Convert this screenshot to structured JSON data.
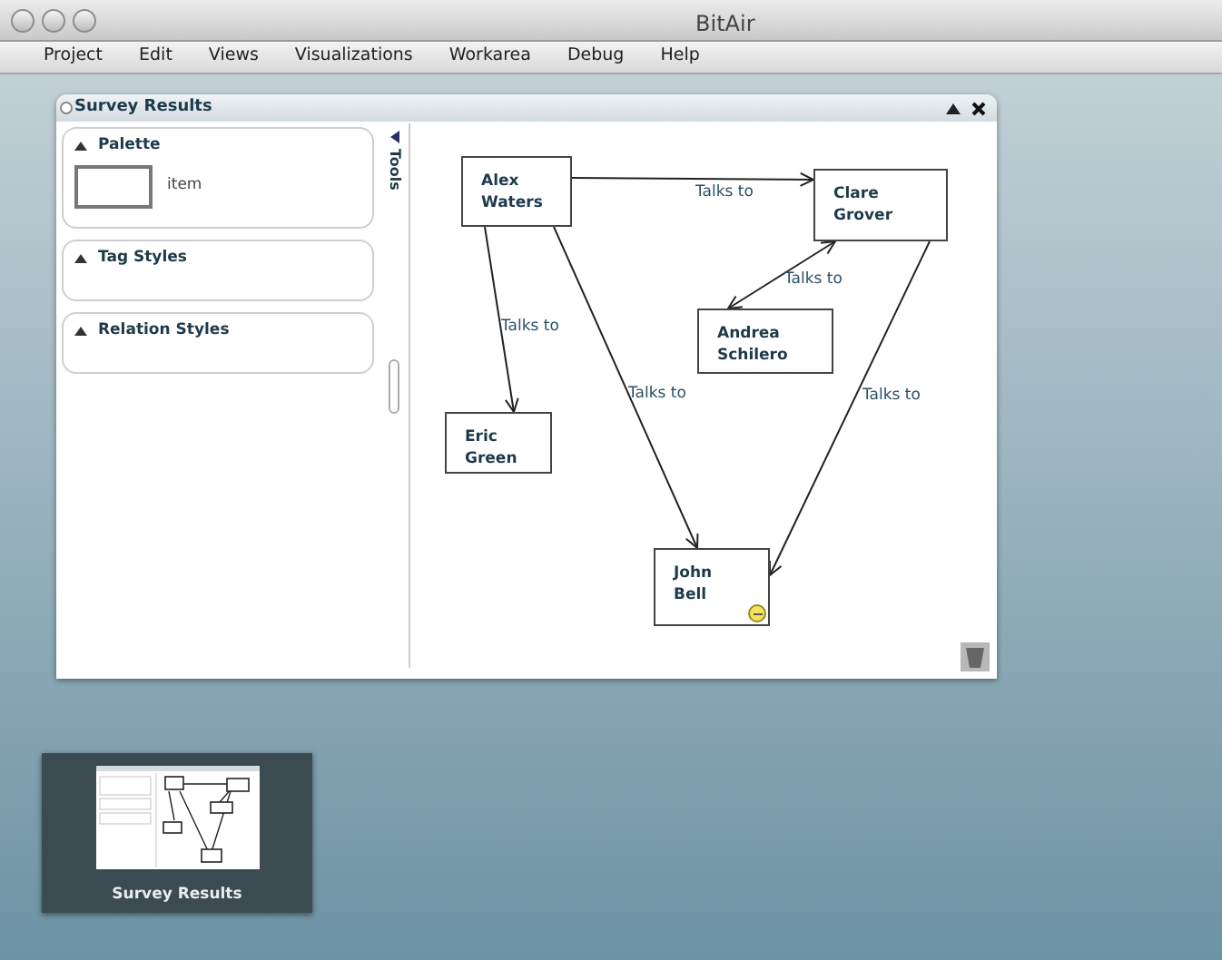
{
  "window": {
    "title": "BitAir"
  },
  "menu": [
    "Project",
    "Edit",
    "Views",
    "Visualizations",
    "Workarea",
    "Debug",
    "Help"
  ],
  "panel": {
    "title": "Survey Results",
    "sections": [
      {
        "title": "Palette",
        "expanded": true,
        "item_label": "item"
      },
      {
        "title": "Tag Styles",
        "expanded": true
      },
      {
        "title": "Relation Styles",
        "expanded": true
      }
    ],
    "tools_label": "Tools",
    "nodes": [
      {
        "lines": [
          "Alex",
          "Waters"
        ],
        "marked": false
      },
      {
        "lines": [
          "Clare",
          "Grover"
        ],
        "marked": false
      },
      {
        "lines": [
          "Andrea",
          "Schilero"
        ],
        "marked": false
      },
      {
        "lines": [
          "Eric",
          "Green"
        ],
        "marked": false
      },
      {
        "lines": [
          "John",
          "Bell"
        ],
        "marked": true
      }
    ],
    "edges": [
      {
        "label": "Talks to",
        "both_ways": false
      },
      {
        "label": "Talks to",
        "both_ways": false
      },
      {
        "label": "Talks to",
        "both_ways": false
      },
      {
        "label": "Talks to",
        "both_ways": true
      },
      {
        "label": "Talks to",
        "both_ways": false
      }
    ]
  },
  "thumbnail": {
    "label": "Survey Results"
  }
}
